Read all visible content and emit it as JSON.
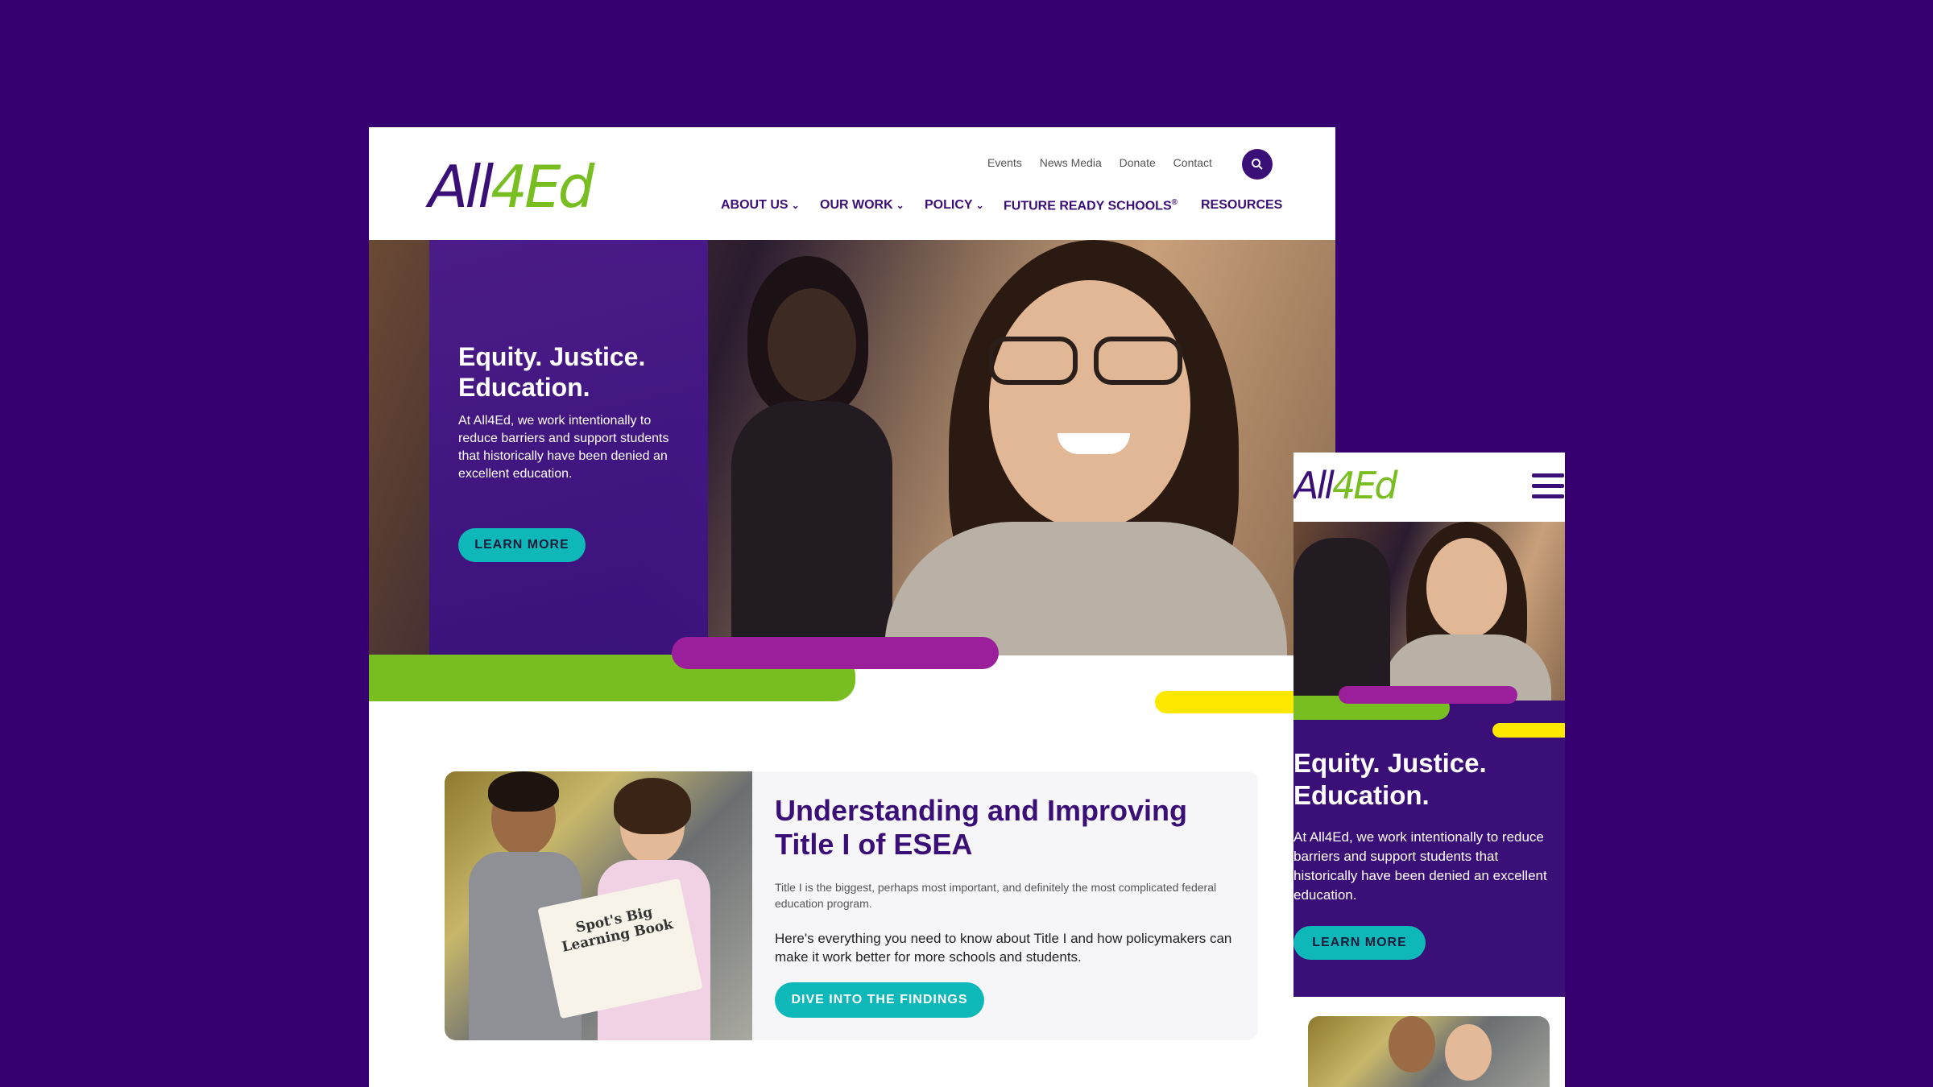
{
  "brand": {
    "logo_part1": "All",
    "logo_part2": "4Ed",
    "purple": "#3b0f78",
    "green": "#78be20",
    "teal": "#0fb8b8",
    "magenta": "#9b1f9b",
    "yellow": "#ffe800"
  },
  "desktop": {
    "util_nav": [
      "Events",
      "News Media",
      "Donate",
      "Contact"
    ],
    "search_icon": "search-icon",
    "main_nav": {
      "about": "ABOUT US",
      "work": "OUR WORK",
      "policy": "POLICY",
      "frs": "FUTURE READY SCHOOLS",
      "frs_sup": "®",
      "resources": "RESOURCES"
    },
    "hero": {
      "title": "Equity. Justice. Education.",
      "text": "At All4Ed, we work intentionally to reduce barriers and support students that historically have been denied an excellent education.",
      "button": "LEARN MORE"
    },
    "card": {
      "title": "Understanding and Improving Title I of ESEA",
      "subtitle": "Title I is the biggest, perhaps most important, and definitely the most complicated federal education program.",
      "body": "Here's everything you need to know about Title I and how policymakers can make it work better for more schools and students.",
      "button": "DIVE INTO THE FINDINGS",
      "book_text": "Spot's Big Learning Book"
    }
  },
  "mobile": {
    "menu_icon": "hamburger-icon",
    "hero": {
      "title": "Equity. Justice. Education.",
      "text": "At All4Ed, we work intentionally to reduce barriers and support students that historically have been denied an excellent education.",
      "button": "LEARN MORE"
    }
  }
}
